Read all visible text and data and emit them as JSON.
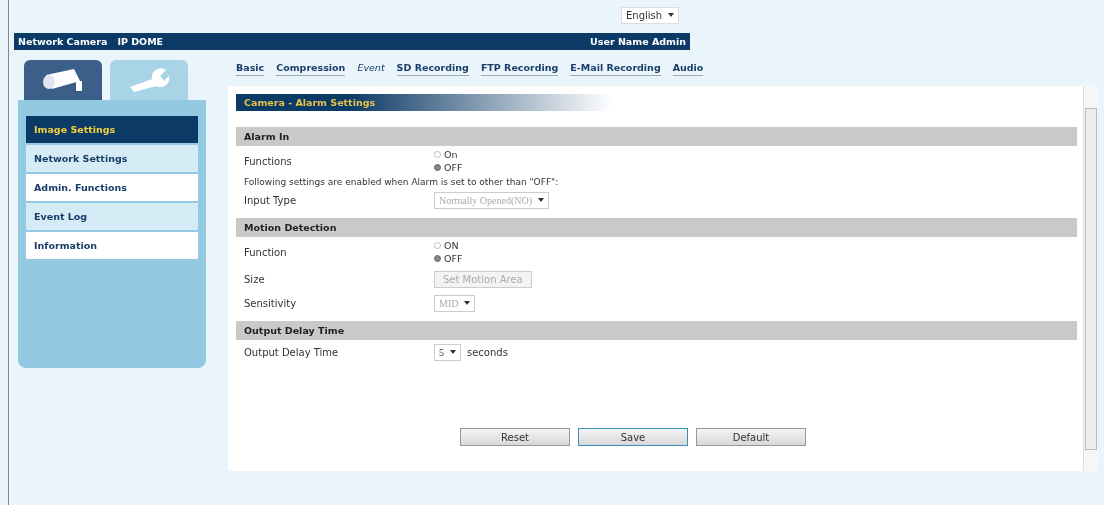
{
  "language": {
    "value": "English"
  },
  "header": {
    "product": "Network Camera",
    "model": "IP DOME",
    "user": "User Name Admin"
  },
  "side_tabs": [
    {
      "kind": "camera",
      "selected": true
    },
    {
      "kind": "wrench",
      "selected": false
    }
  ],
  "sidebar": {
    "items": [
      {
        "label": "Image Settings",
        "selected": true
      },
      {
        "label": "Network Settings",
        "selected": false
      },
      {
        "label": "Admin. Functions",
        "selected": false
      },
      {
        "label": "Event Log",
        "selected": false
      },
      {
        "label": "Information",
        "selected": false
      }
    ]
  },
  "tabs": [
    {
      "label": "Basic",
      "selected": false
    },
    {
      "label": "Compression",
      "selected": false
    },
    {
      "label": "Event",
      "selected": true
    },
    {
      "label": "SD Recording",
      "selected": false
    },
    {
      "label": "FTP Recording",
      "selected": false
    },
    {
      "label": "E-Mail Recording",
      "selected": false
    },
    {
      "label": "Audio",
      "selected": false
    }
  ],
  "page_title": "Camera - Alarm Settings",
  "sections": [
    {
      "title": "Alarm In",
      "fields": [
        {
          "kind": "radio",
          "label": "Functions",
          "options": [
            {
              "label": "On",
              "selected": false
            },
            {
              "label": "OFF",
              "selected": true
            }
          ]
        },
        {
          "kind": "note",
          "text": "Following settings are enabled when Alarm is set to other than \"OFF\":"
        },
        {
          "kind": "select",
          "label": "Input Type",
          "value": "Normally Opened(NO)",
          "disabled": true
        }
      ]
    },
    {
      "title": "Motion Detection",
      "fields": [
        {
          "kind": "radio",
          "label": "Function",
          "options": [
            {
              "label": "ON",
              "selected": false
            },
            {
              "label": "OFF",
              "selected": true
            }
          ]
        },
        {
          "kind": "button",
          "label": "Size",
          "value": "Set Motion Area",
          "disabled": true
        },
        {
          "kind": "select",
          "label": "Sensitivity",
          "value": "MID",
          "disabled": true
        }
      ]
    },
    {
      "title": "Output Delay Time",
      "fields": [
        {
          "kind": "select",
          "label": "Output Delay Time",
          "value": "5",
          "unit": "seconds",
          "disabled": false
        }
      ]
    }
  ],
  "buttons": [
    {
      "label": "Reset",
      "selected": false
    },
    {
      "label": "Save",
      "selected": true
    },
    {
      "label": "Default",
      "selected": false
    }
  ]
}
